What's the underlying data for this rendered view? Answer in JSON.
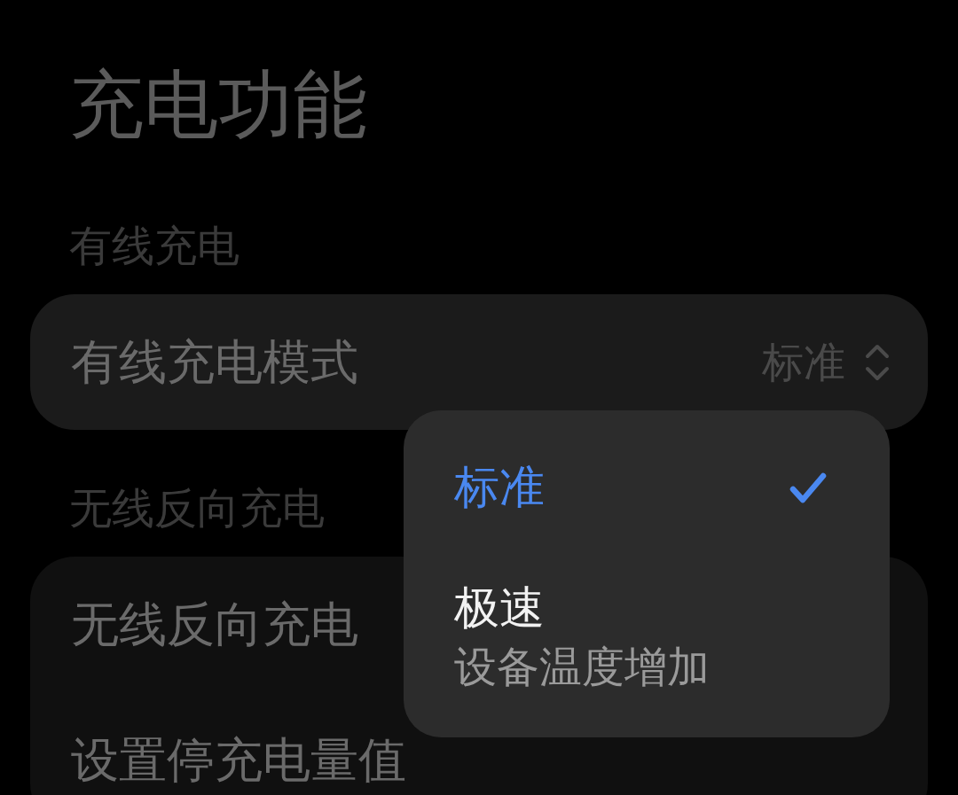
{
  "page": {
    "title": "充电功能"
  },
  "sections": [
    {
      "header": "有线充电",
      "rows": [
        {
          "kind": "select",
          "label": "有线充电模式",
          "value": "标准"
        }
      ]
    },
    {
      "header": "无线反向充电",
      "rows": [
        {
          "kind": "plain",
          "label": "无线反向充电"
        },
        {
          "kind": "plain",
          "label": "设置停充电量值"
        }
      ]
    }
  ],
  "dropdown": {
    "options": [
      {
        "label": "标准",
        "selected": true
      },
      {
        "label": "极速",
        "description": "设备温度增加",
        "selected": false
      }
    ]
  }
}
